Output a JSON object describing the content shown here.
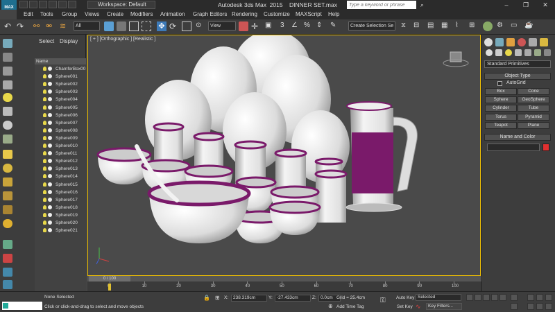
{
  "app": {
    "title": "Autodesk 3ds Max  2015    DINNER SET.max",
    "logo_text": "MAX",
    "workspace": "Workspace: Default",
    "help_search_placeholder": "Type a keyword or phrase",
    "window_buttons": [
      "–",
      "❐",
      "✕"
    ]
  },
  "menu": [
    "Edit",
    "Tools",
    "Group",
    "Views",
    "Create",
    "Modifiers",
    "Animation",
    "Graph Editors",
    "Rendering",
    "Customize",
    "MAXScript",
    "Help"
  ],
  "toolbar": {
    "selection_filter": "All",
    "reference_coord": "View",
    "named_selection": "Create Selection Se"
  },
  "explorer": {
    "tabs": [
      "Select",
      "Display"
    ],
    "column_header": "Name",
    "items": [
      "ChamferBox00",
      "Sphere001",
      "Sphere002",
      "Sphere003",
      "Sphere004",
      "Sphere005",
      "Sphere006",
      "Sphere007",
      "Sphere008",
      "Sphere009",
      "Sphere010",
      "Sphere011",
      "Sphere012",
      "Sphere013",
      "Sphere014",
      "Sphere015",
      "Sphere016",
      "Sphere017",
      "Sphere018",
      "Sphere019",
      "Sphere020",
      "Sphere021"
    ]
  },
  "viewport": {
    "label": "[ + ] [Orthographic ] [Realistic ]"
  },
  "command_panel": {
    "category": "Standard Primitives",
    "object_type_title": "Object Type",
    "autogrid": "AutoGrid",
    "buttons": [
      "Box",
      "Cone",
      "Sphere",
      "GeoSphere",
      "Cylinder",
      "Tube",
      "Torus",
      "Pyramid",
      "Teapot",
      "Plane"
    ],
    "name_color_title": "Name and Color",
    "color": "#e03030"
  },
  "timeline": {
    "frame": "0 / 100",
    "ticks": [
      "0",
      "10",
      "20",
      "30",
      "40",
      "50",
      "60",
      "70",
      "80",
      "90",
      "100"
    ]
  },
  "status": {
    "selection": "None Selected",
    "prompt": "Click or click-and-drag to select and move objects",
    "x_label": "X:",
    "x": "238.319cm",
    "y_label": "Y:",
    "y": "-27.433cm",
    "z_label": "Z:",
    "z": "0.0cm",
    "grid": "Grid = 25.4cm",
    "add_time_tag": "Add Time Tag",
    "auto_key": "Auto Key",
    "set_key": "Set Key",
    "key_mode": "Selected",
    "key_filters": "Key Filters..."
  },
  "colors": {
    "accent_purple": "#7a1a6a",
    "viewport_border": "#f0c000"
  }
}
